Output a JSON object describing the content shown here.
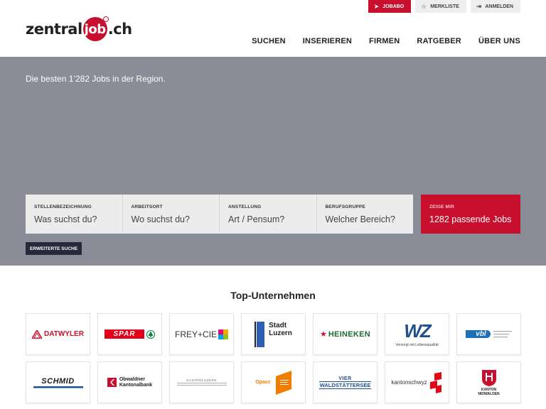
{
  "header": {
    "logo": {
      "left": "zentral",
      "bubble": "job",
      "right": ".ch"
    },
    "top_actions": [
      {
        "label": "JOBABO",
        "icon": "paper-plane-icon"
      },
      {
        "label": "MERKLISTE",
        "icon": "star-icon"
      },
      {
        "label": "ANMELDEN",
        "icon": "login-icon"
      }
    ],
    "nav": [
      "SUCHEN",
      "INSERIEREN",
      "FIRMEN",
      "RATGEBER",
      "ÜBER UNS"
    ]
  },
  "hero": {
    "title": "Die besten 1’282 Jobs in der Region.",
    "fields": [
      {
        "label": "STELLENBEZEICHNUNG",
        "placeholder": "Was suchst du?"
      },
      {
        "label": "ARBEITSORT",
        "placeholder": "Wo suchst du?"
      },
      {
        "label": "ANSTELLUNG",
        "placeholder": "Art / Pensum?"
      },
      {
        "label": "BERUFSGRUPPE",
        "placeholder": "Welcher Bereich?"
      }
    ],
    "submit": {
      "label": "ZEIGE MIR",
      "count": "1282 passende Jobs"
    },
    "advanced": "ERWEITERTE SUCHE"
  },
  "companies": {
    "title": "Top-Unternehmen",
    "logos": {
      "datwyler": "DATWYLER",
      "spar": "SPAR",
      "frey": "FREY+CIE",
      "stadt": "Stadt",
      "luzern": "Luzern",
      "heineken": "HEINEKEN",
      "wz": "WZ",
      "wz_tag": "Versorgt mit Lebensqualität",
      "vbl": "vbl",
      "schmid": "SCHMID",
      "okb1": "Obwaldner",
      "okb2": "Kantonalbank",
      "gl": "GASTROLUZERN",
      "opacc": "Opacc",
      "vier1": "VIER",
      "vier2": "WALDSTÄTTERSEE",
      "ksz": "kantonschwyz",
      "nw1": "KANTON",
      "nw2": "NIDWALDEN"
    }
  },
  "colors": {
    "brand_red": "#c8102e",
    "hero_gray": "#8a8c98",
    "dark_button": "#262a3b"
  }
}
